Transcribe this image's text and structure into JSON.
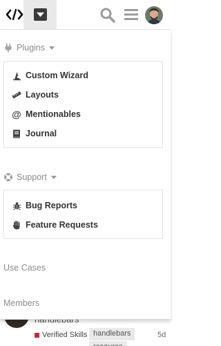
{
  "header": {
    "logo_icon": "code-brackets-icon",
    "menu_icon": "dropdown-caret-icon",
    "search_icon": "search-icon",
    "hamburger_icon": "hamburger-icon",
    "avatar": "user-avatar"
  },
  "panel": {
    "plugins": {
      "heading": "Plugins",
      "items": [
        {
          "label": "Custom Wizard",
          "icon": "wizard-hat-icon"
        },
        {
          "label": "Layouts",
          "icon": "ruler-icon"
        },
        {
          "label": "Mentionables",
          "icon": "at-sign-icon"
        },
        {
          "label": "Journal",
          "icon": "book-icon"
        }
      ]
    },
    "support": {
      "heading": "Support",
      "items": [
        {
          "label": "Bug Reports",
          "icon": "bug-icon"
        },
        {
          "label": "Feature Requests",
          "icon": "hand-icon"
        }
      ]
    },
    "links": {
      "use_cases": "Use Cases",
      "members": "Members"
    }
  },
  "background_topic": {
    "title": "handlebars",
    "category": "Verified Skills",
    "category_color": "#c5283d",
    "tags": [
      "handlebars",
      "resource"
    ],
    "age": "5d"
  },
  "colors": {
    "menu_tab_bg": "#e9e9e9",
    "muted_text": "#8c8c8c",
    "item_text": "#333333"
  }
}
